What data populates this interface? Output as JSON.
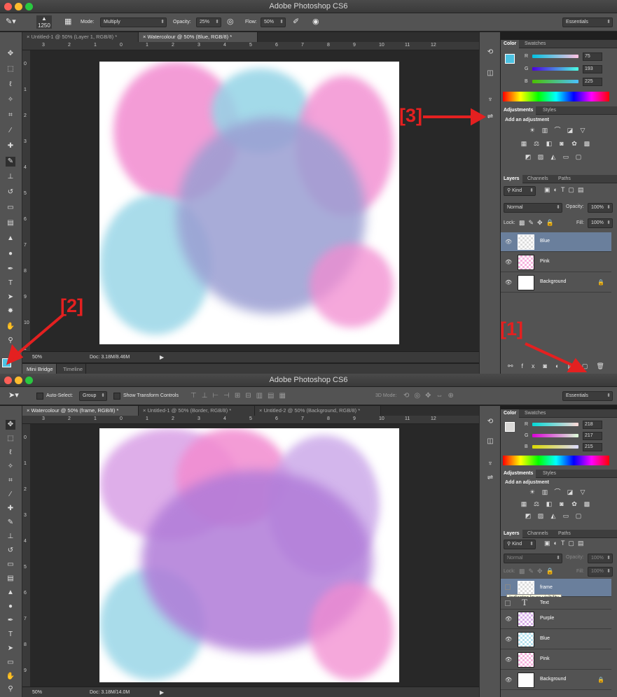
{
  "windows": [
    {
      "title": "Adobe Photoshop CS6",
      "options": {
        "brush_size": "1250",
        "mode_label": "Mode:",
        "mode_value": "Multiply",
        "opacity_label": "Opacity:",
        "opacity_value": "25%",
        "flow_label": "Flow:",
        "flow_value": "50%"
      },
      "workspace": "Essentials",
      "tabs": [
        "Untitled-1 @ 50% (Layer 1, RGB/8) *",
        "Watercolour @ 50% (Blue, RGB/8) *"
      ],
      "active_tab": 1,
      "ruler_h": [
        "3",
        "2",
        "1",
        "0",
        "1",
        "2",
        "3",
        "4",
        "5",
        "6",
        "7",
        "8",
        "9",
        "10",
        "11",
        "12"
      ],
      "ruler_v": [
        "0",
        "1",
        "2",
        "3",
        "4",
        "5",
        "6",
        "7",
        "8",
        "9",
        "10",
        "1"
      ],
      "status": {
        "zoom": "50%",
        "doc": "Doc: 3.18M/8.46M"
      },
      "bottom_tabs": [
        "Mini Bridge",
        "Timeline"
      ],
      "color_panel": {
        "tabs": [
          "Color",
          "Swatches"
        ],
        "labels": [
          "R",
          "G",
          "B"
        ],
        "values": [
          "75",
          "193",
          "225"
        ],
        "fg": "#4bc1e1"
      },
      "adjustments": {
        "tabs": [
          "Adjustments",
          "Styles"
        ],
        "heading": "Add an adjustment"
      },
      "layers_panel": {
        "tabs": [
          "Layers",
          "Channels",
          "Paths"
        ],
        "kind": "Kind",
        "blend": "Normal",
        "opacity_label": "Opacity:",
        "opacity": "100%",
        "lock_label": "Lock:",
        "fill_label": "Fill:",
        "fill": "100%"
      },
      "layers": [
        {
          "name": "Blue",
          "selected": true
        },
        {
          "name": "Pink",
          "selected": false
        },
        {
          "name": "Background",
          "selected": false
        }
      ]
    },
    {
      "title": "Adobe Photoshop CS6",
      "options": {
        "auto_select_label": "Auto-Select:",
        "auto_select_value": "Group",
        "transform_label": "Show Transform Controls",
        "mode3d_label": "3D Mode:"
      },
      "workspace": "Essentials",
      "tabs": [
        "Watercolour @ 50% (frame, RGB/8) *",
        "Untitled-1 @ 50% (Border, RGB/8) *",
        "Untitled-2 @ 50% (Background, RGB/8) *"
      ],
      "active_tab": 0,
      "ruler_h": [
        "3",
        "2",
        "1",
        "0",
        "1",
        "2",
        "3",
        "4",
        "5",
        "6",
        "7",
        "8",
        "9",
        "10",
        "11",
        "12"
      ],
      "ruler_v": [
        "0",
        "1",
        "2",
        "3",
        "4",
        "5",
        "6",
        "7",
        "8",
        "9"
      ],
      "status": {
        "zoom": "50%",
        "doc": "Doc: 3.18M/14.0M"
      },
      "color_panel": {
        "tabs": [
          "Color",
          "Swatches"
        ],
        "labels": [
          "R",
          "G",
          "B"
        ],
        "values": [
          "218",
          "217",
          "215"
        ],
        "fg": "#dad9d7"
      },
      "adjustments": {
        "tabs": [
          "Adjustments",
          "Styles"
        ],
        "heading": "Add an adjustment"
      },
      "layers_panel": {
        "tabs": [
          "Layers",
          "Channels",
          "Paths"
        ],
        "kind": "Kind",
        "blend": "Normal",
        "opacity_label": "Opacity:",
        "opacity": "100%",
        "lock_label": "Lock:",
        "fill_label": "Fill:",
        "fill": "100%"
      },
      "layers": [
        {
          "name": "frame",
          "selected": true
        },
        {
          "name": "Text",
          "selected": false
        },
        {
          "name": "Purple",
          "selected": false
        },
        {
          "name": "Blue",
          "selected": false
        },
        {
          "name": "Pink",
          "selected": false
        },
        {
          "name": "Background",
          "selected": false
        }
      ],
      "tooltip": "Indicates layer visibility"
    }
  ],
  "callouts": [
    "[1]",
    "[2]",
    "[3]"
  ],
  "colors": {
    "accent_red": "#e42020",
    "pink": "#f28bd0",
    "blue": "#94d4e6",
    "purple": "#b07bd8"
  }
}
